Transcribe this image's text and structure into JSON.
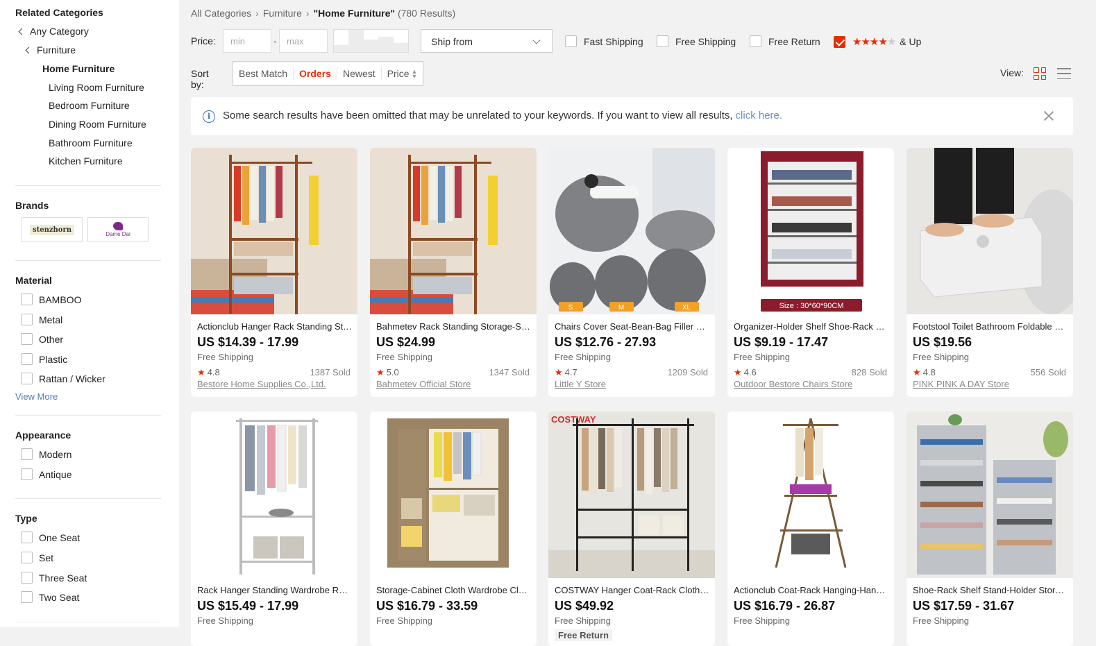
{
  "sidebar": {
    "related_title": "Related Categories",
    "categories": [
      {
        "label": "Any Category"
      },
      {
        "label": "Furniture"
      },
      {
        "label": "Home Furniture"
      },
      {
        "label": "Living Room Furniture"
      },
      {
        "label": "Bedroom Furniture"
      },
      {
        "label": "Dining Room Furniture"
      },
      {
        "label": "Bathroom Furniture"
      },
      {
        "label": "Kitchen Furniture"
      }
    ],
    "brands_title": "Brands",
    "brands": [
      "stenzhorn",
      "Dame Dai"
    ],
    "material_title": "Material",
    "materials": [
      "BAMBOO",
      "Metal",
      "Other",
      "Plastic",
      "Rattan / Wicker"
    ],
    "view_more": "View More",
    "appearance_title": "Appearance",
    "appearances": [
      "Modern",
      "Antique"
    ],
    "type_title": "Type",
    "types": [
      "One Seat",
      "Set",
      "Three Seat",
      "Two Seat"
    ]
  },
  "breadcrumb": {
    "all": "All Categories",
    "parent": "Furniture",
    "current": "\"Home Furniture\"",
    "results": "(780 Results)"
  },
  "filters": {
    "price_label": "Price:",
    "min_placeholder": "min",
    "max_placeholder": "max",
    "dash": "-",
    "ship_from": "Ship from",
    "fast_shipping": "Fast Shipping",
    "free_shipping": "Free Shipping",
    "free_return": "Free Return",
    "rating_suffix": "& Up",
    "rating_checked": true,
    "rating_stars": 4
  },
  "sort": {
    "label": "Sort by:",
    "options": [
      "Best Match",
      "Orders",
      "Newest",
      "Price"
    ],
    "active": "Orders"
  },
  "view": {
    "label": "View:"
  },
  "notice": {
    "message": "Some search results have been omitted that may be unrelated to your keywords. If you want to view all results,",
    "link": "click here."
  },
  "products": [
    {
      "title": "Actionclub Hanger Rack Standing Storage Clothes Rack",
      "price": "US $14.39 - 17.99",
      "shipping": "Free Shipping",
      "rating": "4.8",
      "sold": "1387 Sold",
      "store": "Bestore Home Supplies Co.,Ltd."
    },
    {
      "title": "Bahmetev Rack Standing Storage-Shelf",
      "price": "US $24.99",
      "shipping": "Free Shipping",
      "rating": "5.0",
      "sold": "1347 Sold",
      "store": "Bahmetev Official Store"
    },
    {
      "title": "Chairs Cover Seat-Bean-Bag Filler Sofa",
      "price": "US $12.76 - 27.93",
      "shipping": "Free Shipping",
      "rating": "4.7",
      "sold": "1209 Sold",
      "store": "Little Y Store",
      "size_tags": [
        "S",
        "M",
        "XL"
      ]
    },
    {
      "title": "Organizer-Holder Shelf Shoe-Rack Cabinet",
      "price": "US $9.19 - 17.47",
      "shipping": "Free Shipping",
      "rating": "4.6",
      "sold": "828 Sold",
      "store": "Outdoor Bestore Chairs Store",
      "size_tag": "Size : 30*60*90CM"
    },
    {
      "title": "Footstool Toilet Bathroom Foldable Stool",
      "price": "US $19.56",
      "shipping": "Free Shipping",
      "rating": "4.8",
      "sold": "556 Sold",
      "store": "PINK PINK A DAY Store"
    },
    {
      "title": "Rack Hanger Standing Wardrobe Rack",
      "price": "US $15.49 - 17.99",
      "shipping": "Free Shipping"
    },
    {
      "title": "Storage-Cabinet Cloth Wardrobe Closet",
      "price": "US $16.79 - 33.59",
      "shipping": "Free Shipping"
    },
    {
      "title": "COSTWAY Hanger Coat-Rack Clothing Rack",
      "price": "US $49.92",
      "shipping": "Free Shipping",
      "badge": "Free Return",
      "brand_mark": "COSTWAY"
    },
    {
      "title": "Actionclub Coat-Rack Hanging-Hanger Rack",
      "price": "US $16.79 - 26.87",
      "shipping": "Free Shipping"
    },
    {
      "title": "Shoe-Rack Shelf Stand-Holder Storage",
      "price": "US $17.59 - 31.67",
      "shipping": "Free Shipping"
    }
  ],
  "colors": {
    "accent": "#e62e04",
    "link": "#4e7bb6"
  }
}
